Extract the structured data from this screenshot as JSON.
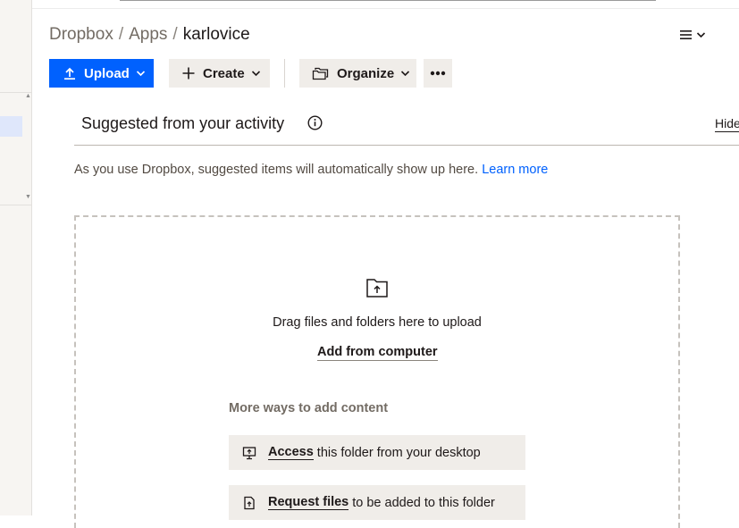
{
  "breadcrumb": {
    "items": [
      "Dropbox",
      "Apps"
    ],
    "separator": "/",
    "current": "karlovice"
  },
  "toolbar": {
    "upload_label": "Upload",
    "create_label": "Create",
    "organize_label": "Organize"
  },
  "suggested": {
    "title": "Suggested from your activity",
    "hide_label": "Hide",
    "description": "As you use Dropbox, suggested items will automatically show up here.",
    "learn_more": "Learn more"
  },
  "dropzone": {
    "drag_text": "Drag files and folders here to upload",
    "add_from_computer": "Add from computer",
    "more_ways_title": "More ways to add content",
    "options": [
      {
        "strong": "Access",
        "rest": "this folder from your desktop",
        "icon": "desktop-icon"
      },
      {
        "strong": "Request files",
        "rest": "to be added to this folder",
        "icon": "request-file-icon"
      }
    ]
  },
  "colors": {
    "accent": "#0061fe",
    "button_bg": "#f0ede9",
    "text": "#1e1919",
    "muted": "#736c64"
  }
}
